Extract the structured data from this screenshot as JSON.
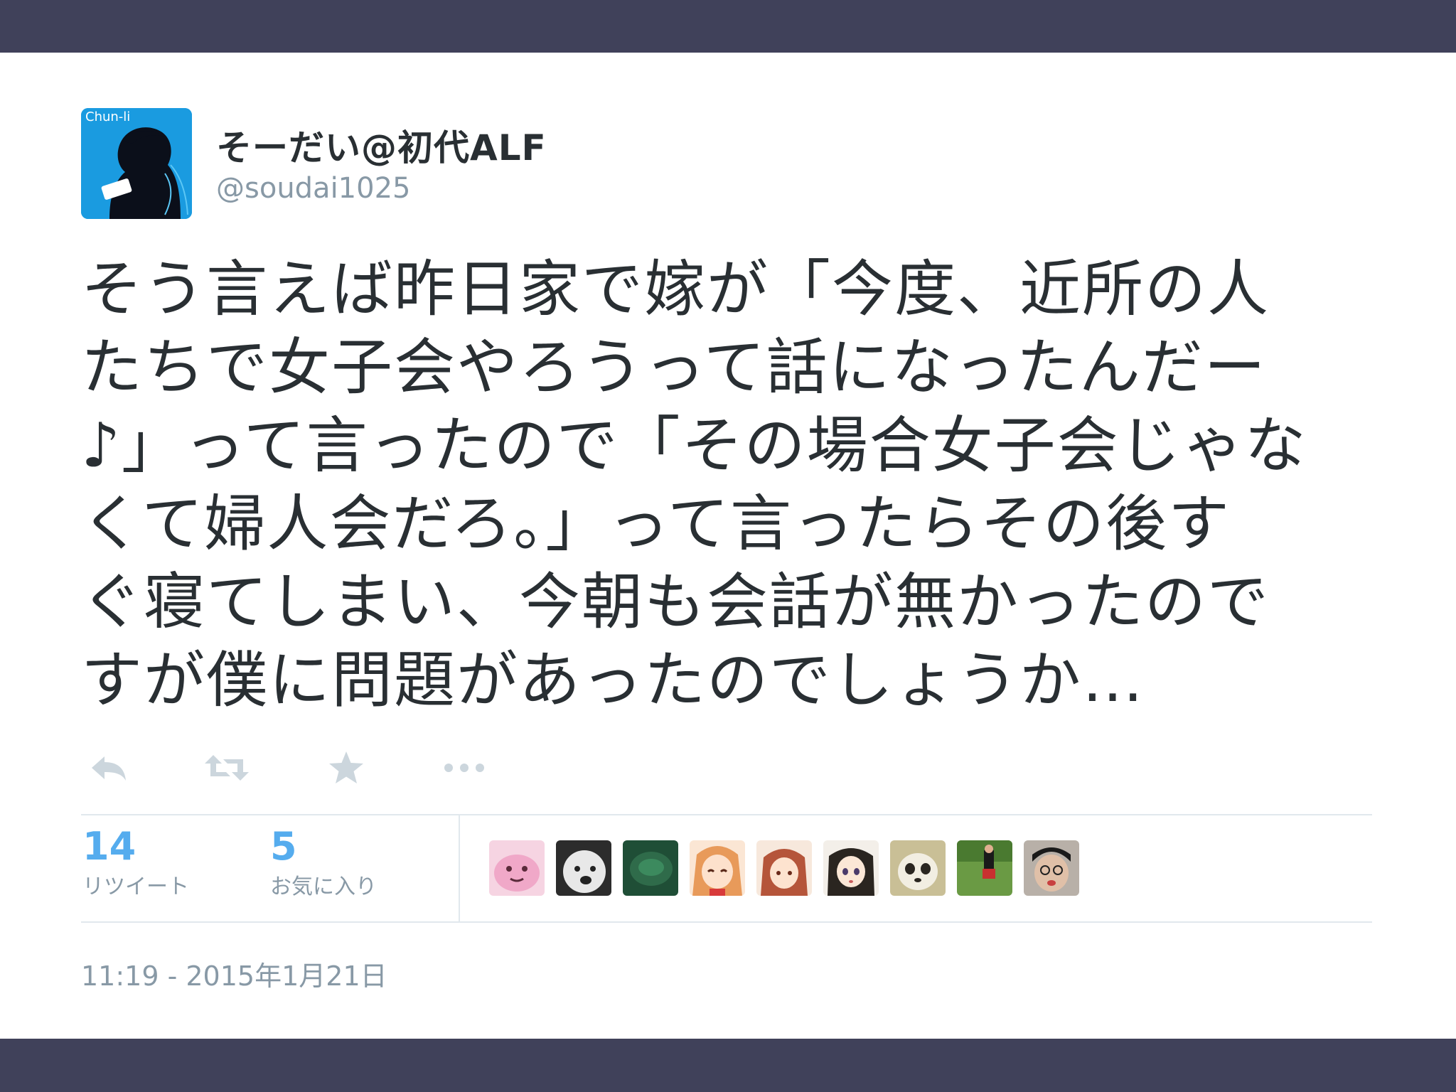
{
  "user": {
    "display_name": "そーだい@初代ALF",
    "handle": "@soudai1025",
    "avatar_label": "Chun-li"
  },
  "tweet": {
    "lines": [
      "そう言えば昨日家で嫁が「今度、近所の人",
      "たちで女子会やろうって話になったんだー",
      "♪」って言ったので「その場合女子会じゃな",
      "くて婦人会だろ。」って言ったらその後す",
      "ぐ寝てしまい、今朝も会話が無かったので",
      "すが僕に問題があったのでしょうか…"
    ]
  },
  "actions": [
    {
      "name": "reply",
      "icon": "reply-icon"
    },
    {
      "name": "retweet",
      "icon": "retweet-icon"
    },
    {
      "name": "favorite",
      "icon": "star-icon"
    },
    {
      "name": "more",
      "icon": "ellipsis-icon"
    }
  ],
  "stats": {
    "retweets": {
      "count": "14",
      "label": "リツイート"
    },
    "favorites": {
      "count": "5",
      "label": "お気に入り"
    }
  },
  "favoriters": [
    {
      "name": "pink-character-avatar",
      "color": "#f0a8c8"
    },
    {
      "name": "white-dog-avatar",
      "color": "#d8d8d8"
    },
    {
      "name": "green-avatar",
      "color": "#2f6b4a"
    },
    {
      "name": "anime-girl-orange-avatar",
      "color": "#e89a5a"
    },
    {
      "name": "anime-girl-brown-hair-avatar",
      "color": "#b5553a"
    },
    {
      "name": "anime-girl-black-hair-avatar",
      "color": "#2a2520"
    },
    {
      "name": "panda-avatar",
      "color": "#c9bf96"
    },
    {
      "name": "outdoor-figure-avatar",
      "color": "#5a8a3a"
    },
    {
      "name": "cartoon-face-avatar",
      "color": "#b8b0a8"
    }
  ],
  "timestamp": "11:19 - 2015年1月21日",
  "colors": {
    "frame": "#40415a",
    "accent": "#55acee",
    "text": "#292f33",
    "muted": "#8899a6",
    "avatar_bg": "#1a9be0"
  }
}
